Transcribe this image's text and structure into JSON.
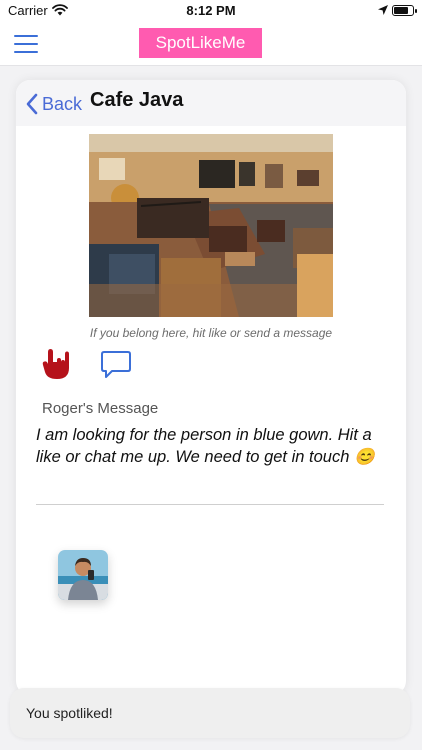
{
  "status_bar": {
    "carrier": "Carrier",
    "time": "8:12 PM",
    "battery_level": 0.85
  },
  "nav": {
    "brand": "SpotLikeMe",
    "accent_color": "#3b6fd8",
    "brand_color": "#ff5bb0"
  },
  "card": {
    "back_label": "Back",
    "title": "Cafe Java",
    "photo_icon": "cafe-interior-photo",
    "hint": "If you belong here, hit like or send a message",
    "like_icon": "rock-hand-icon",
    "chat_icon": "chat-bubble-icon",
    "message_heading": "Roger's Message",
    "message_text": "I am looking for the person in blue gown. Hit a like or chat me up. We need to get in touch 😊",
    "avatar_icon": "user-avatar"
  },
  "toast": {
    "text": "You spotliked!"
  }
}
